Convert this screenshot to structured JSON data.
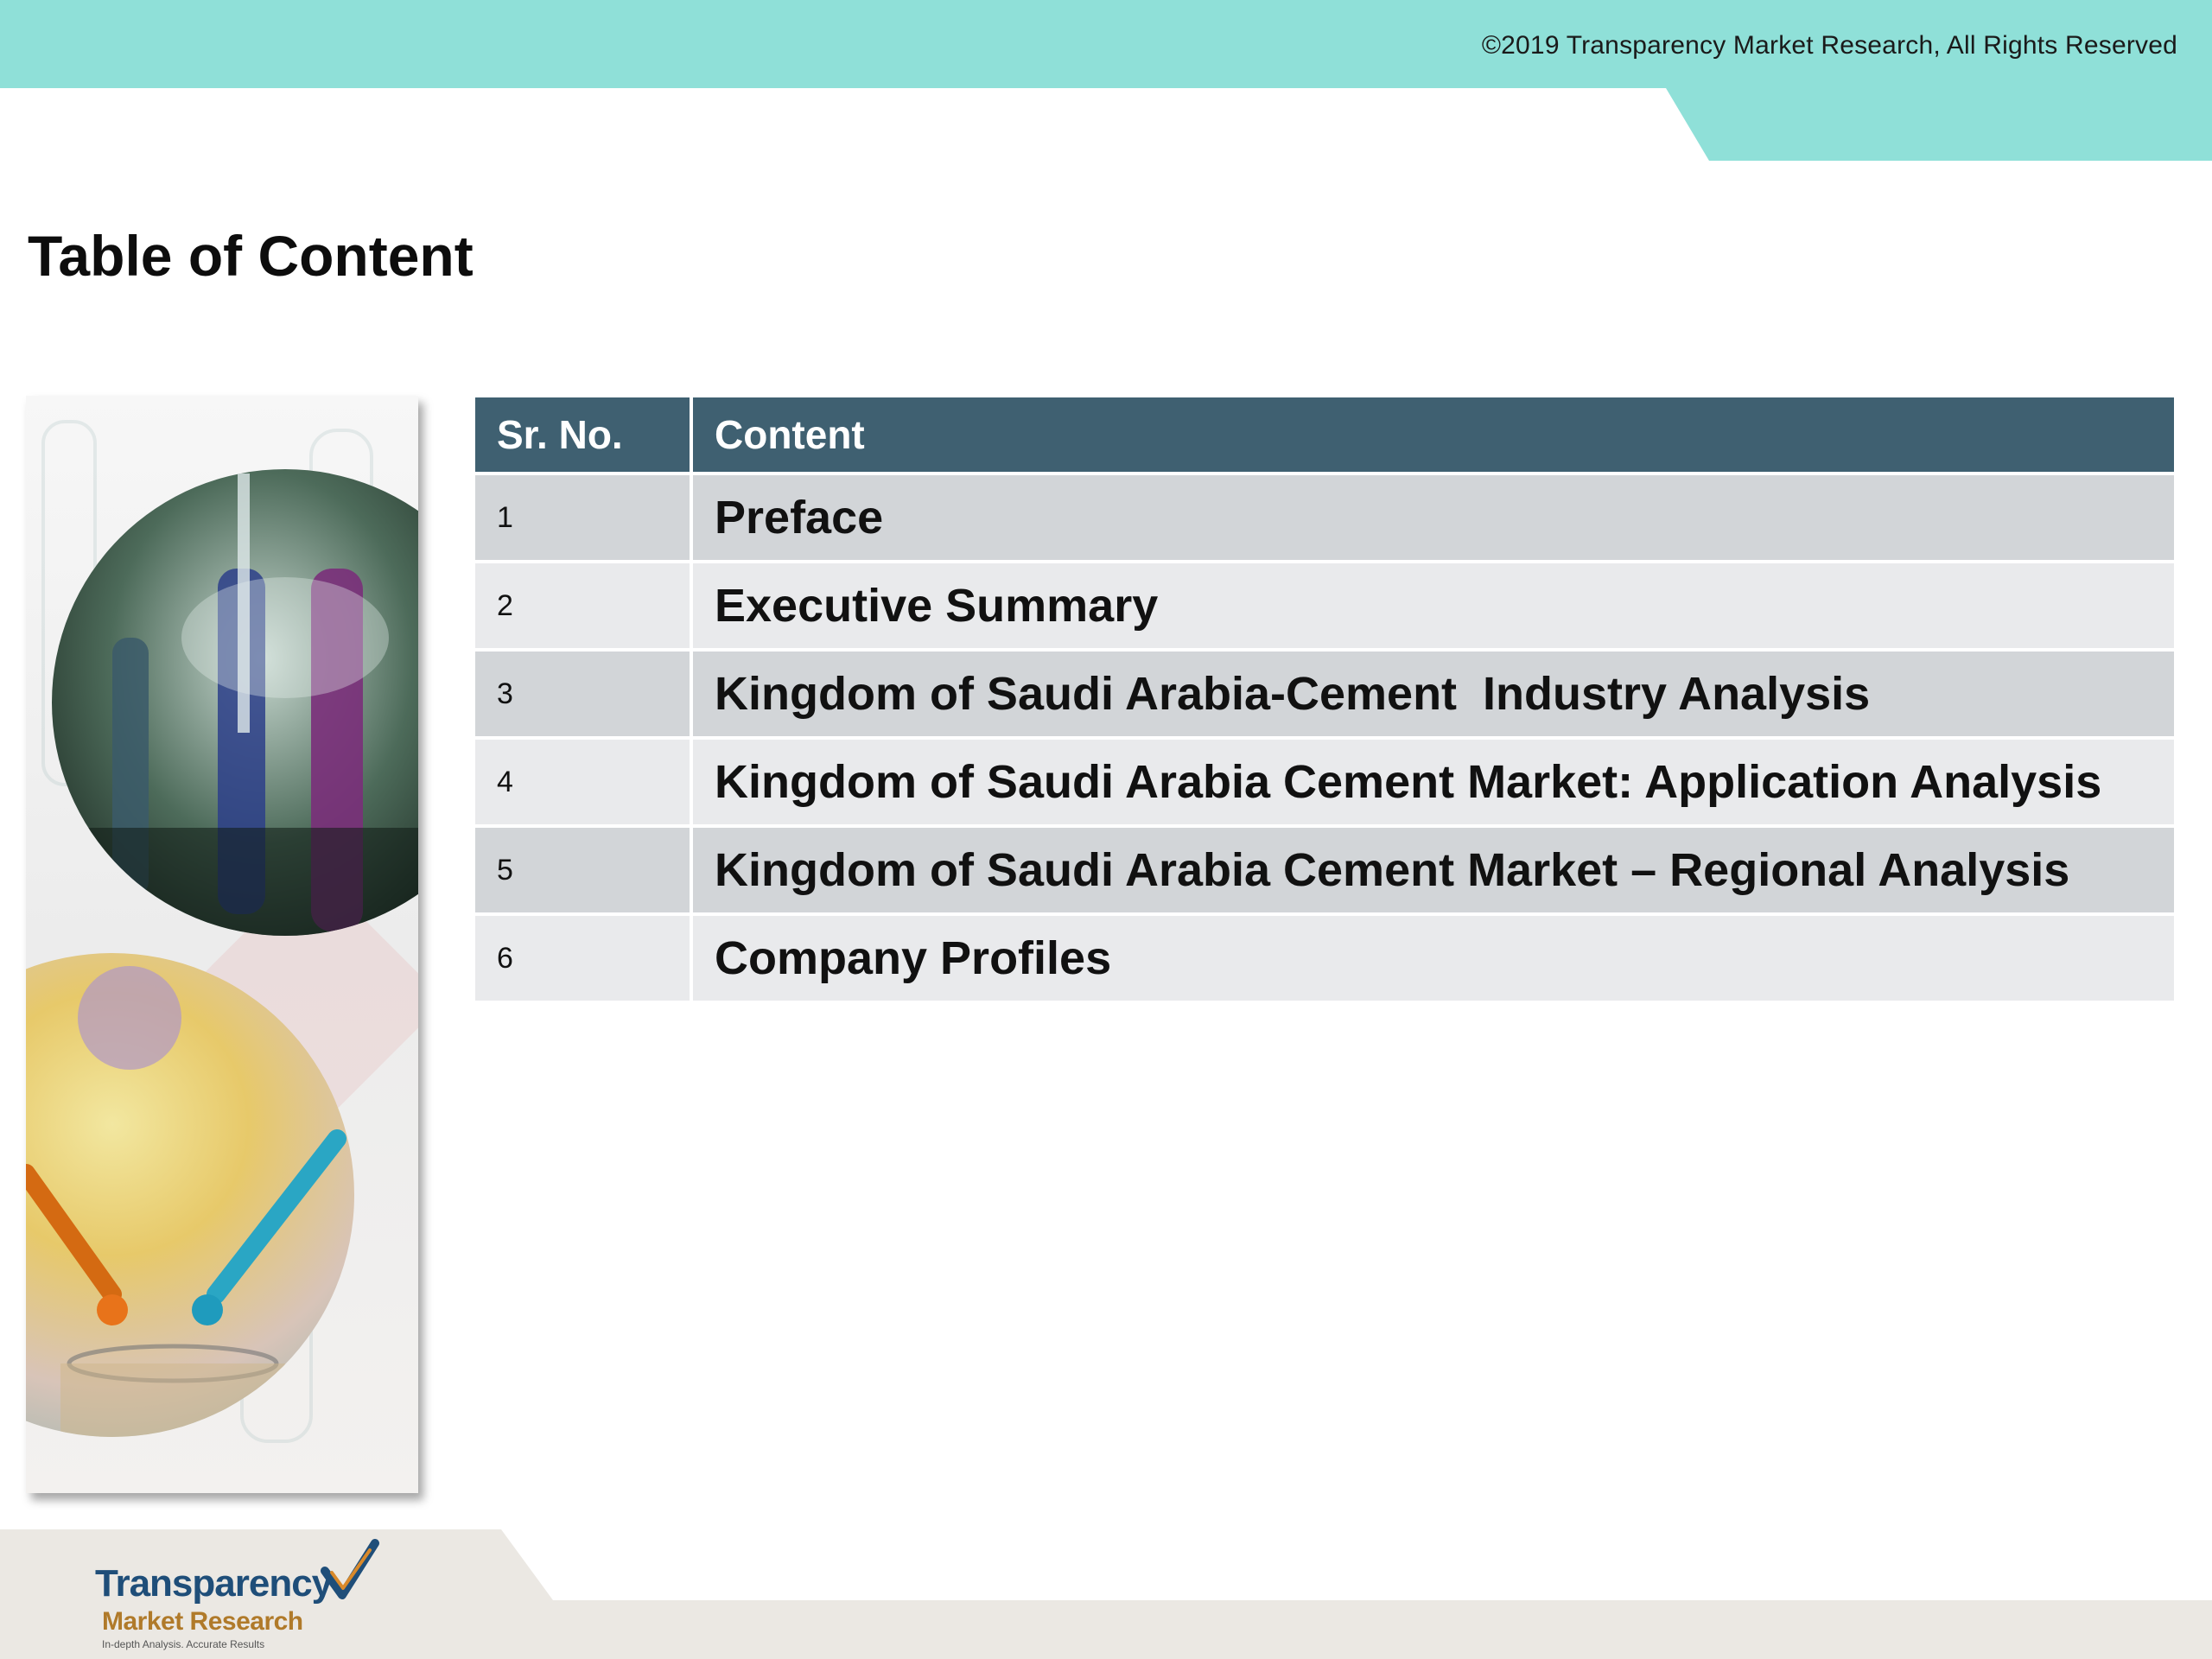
{
  "header": {
    "copyright": "©2019 Transparency Market Research, All Rights Reserved"
  },
  "page_title": "Table of Content",
  "toc": {
    "columns": [
      "Sr. No.",
      "Content"
    ],
    "rows": [
      {
        "no": "1",
        "content": "Preface"
      },
      {
        "no": "2",
        "content": "Executive Summary"
      },
      {
        "no": "3",
        "content": "Kingdom of Saudi Arabia-Cement  Industry Analysis"
      },
      {
        "no": "4",
        "content": "Kingdom of Saudi Arabia Cement Market: Application Analysis"
      },
      {
        "no": "5",
        "content": "Kingdom of Saudi Arabia Cement Market – Regional Analysis"
      },
      {
        "no": "6",
        "content": "Company Profiles"
      }
    ]
  },
  "logo": {
    "line1": "Transparency",
    "line2": "Market Research",
    "line3": "In-depth Analysis. Accurate Results"
  },
  "colors": {
    "teal_band": "#8fe0d8",
    "header_row": "#3f6071",
    "row_odd": "#d2d5d8",
    "row_even": "#e9eaec",
    "footer_band": "#ebe8e3"
  }
}
